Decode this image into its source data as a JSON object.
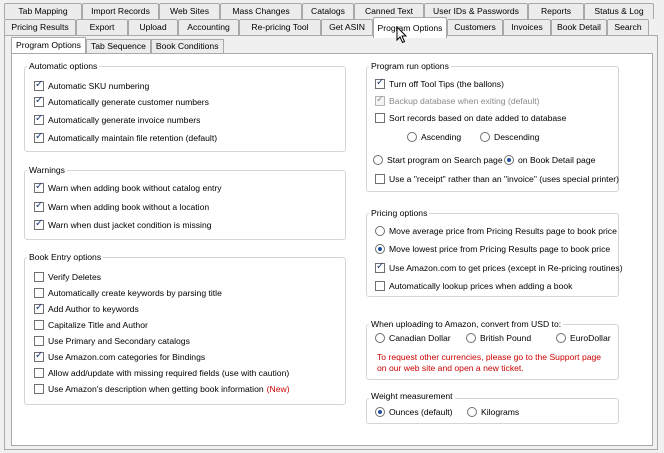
{
  "tabs_row1": [
    "Tab Mapping",
    "Import Records",
    "Web Sites",
    "Mass Changes",
    "Catalogs",
    "Canned Text",
    "User IDs & Passwords",
    "Reports",
    "Status & Log"
  ],
  "tabs_row2": [
    "Pricing Results",
    "Export",
    "Upload",
    "Accounting",
    "Re-pricing Tool",
    "Get ASIN",
    "Program Options",
    "Customers",
    "Invoices",
    "Book Detail",
    "Search"
  ],
  "subtabs": [
    "Program Options",
    "Tab Sequence",
    "Book Conditions"
  ],
  "automatic": {
    "title": "Automatic options",
    "items": [
      {
        "label": "Automatic SKU numbering",
        "checked": true
      },
      {
        "label": "Automatically generate customer numbers",
        "checked": true
      },
      {
        "label": "Automatically generate invoice numbers",
        "checked": true
      },
      {
        "label": "Automatically maintain file retention (default)",
        "checked": true
      }
    ]
  },
  "warnings": {
    "title": "Warnings",
    "items": [
      {
        "label": "Warn when adding book without catalog entry",
        "checked": true
      },
      {
        "label": "Warn when adding book without a location",
        "checked": true
      },
      {
        "label": "Warn when dust jacket condition is missing",
        "checked": true
      }
    ]
  },
  "book_entry": {
    "title": "Book Entry options",
    "items": [
      {
        "label": "Verify Deletes",
        "checked": false
      },
      {
        "label": "Automatically create keywords by parsing title",
        "checked": false
      },
      {
        "label": "Add Author to keywords",
        "checked": true
      },
      {
        "label": "Capitalize Title and Author",
        "checked": false
      },
      {
        "label": "Use Primary and Secondary catalogs",
        "checked": false
      },
      {
        "label": "Use Amazon.com categories for Bindings",
        "checked": true
      },
      {
        "label": "Allow add/update with missing required fields (use with caution)",
        "checked": false
      },
      {
        "label": "Use Amazon's description when getting book information",
        "checked": false
      }
    ],
    "new_badge": "(New)"
  },
  "program_run": {
    "title": "Program run options",
    "tooltips": "Turn off Tool Tips (the ballons)",
    "backup": "Backup database when exiting (default)",
    "sort": "Sort records based on date added to database",
    "ascending": "Ascending",
    "descending": "Descending",
    "start_search": "Start program on Search page",
    "start_detail": "on Book Detail page",
    "receipt": "Use a \"receipt\" rather than an \"invoice\" (uses special printer)"
  },
  "pricing": {
    "title": "Pricing options",
    "avg": "Move average price from Pricing Results page to book price",
    "lowest": "Move lowest price from Pricing Results page to book price",
    "amazon": "Use Amazon.com to get prices (except in Re-pricing routines)",
    "lookup": "Automatically lookup prices when adding a book"
  },
  "upload": {
    "title": "When uploading to Amazon, convert from USD to:",
    "cad": "Canadian Dollar",
    "gbp": "British Pound",
    "eur": "EuroDollar",
    "note1": "To request other currencies, please go to the Support page",
    "note2": "on our web site and open a new ticket."
  },
  "weight": {
    "title": "Weight measurement",
    "oz": "Ounces (default)",
    "kg": "Kilograms"
  },
  "colors": {
    "accent": "#1f4f9a",
    "note": "#cc0000"
  }
}
